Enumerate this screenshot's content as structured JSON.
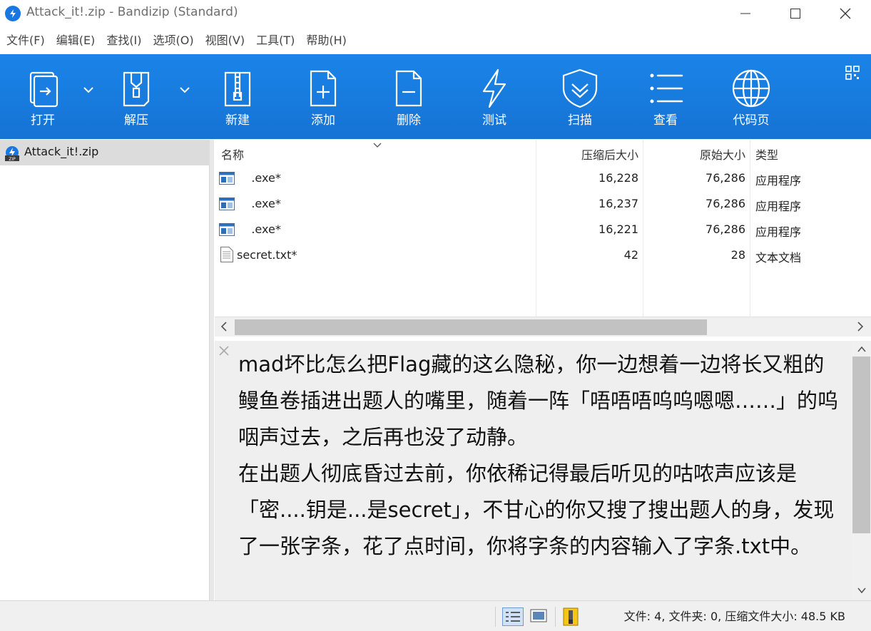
{
  "window": {
    "title": "Attack_it!.zip - Bandizip (Standard)"
  },
  "menu": [
    "文件(F)",
    "编辑(E)",
    "查找(I)",
    "选项(O)",
    "视图(V)",
    "工具(T)",
    "帮助(H)"
  ],
  "toolbar": {
    "open": "打开",
    "extract": "解压",
    "new": "新建",
    "add": "添加",
    "delete": "删除",
    "test": "测试",
    "scan": "扫描",
    "view": "查看",
    "codepage": "代码页"
  },
  "tree": {
    "archive": "Attack_it!.zip"
  },
  "columns": {
    "name": "名称",
    "compressed": "压缩后大小",
    "original": "原始大小",
    "type": "类型"
  },
  "files": [
    {
      "name": "    .exe*",
      "compressed": "16,228",
      "original": "76,286",
      "type": "应用程序",
      "icon": "exe-icon"
    },
    {
      "name": "    .exe*",
      "compressed": "16,237",
      "original": "76,286",
      "type": "应用程序",
      "icon": "exe-icon"
    },
    {
      "name": "    .exe*",
      "compressed": "16,221",
      "original": "76,286",
      "type": "应用程序",
      "icon": "exe-icon"
    },
    {
      "name": "secret.txt*",
      "compressed": "42",
      "original": "28",
      "type": "文本文档",
      "icon": "text-file-icon"
    }
  ],
  "preview": {
    "text": "mad坏比怎么把Flag藏的这么隐秘，你一边想着一边将长又粗的鳗鱼卷插进出题人的嘴里，随着一阵「唔唔唔呜呜嗯嗯……」的呜咽声过去，之后再也没了动静。\n在出题人彻底昏过去前，你依稀记得最后听见的咕哝声应该是「密....钥是...是secret」，不甘心的你又搜了搜出题人的身，发现了一张字条，花了点时间，你将字条的内容输入了字条.txt中。"
  },
  "status": {
    "text": "文件: 4, 文件夹: 0, 压缩文件大小: 48.5 KB"
  }
}
